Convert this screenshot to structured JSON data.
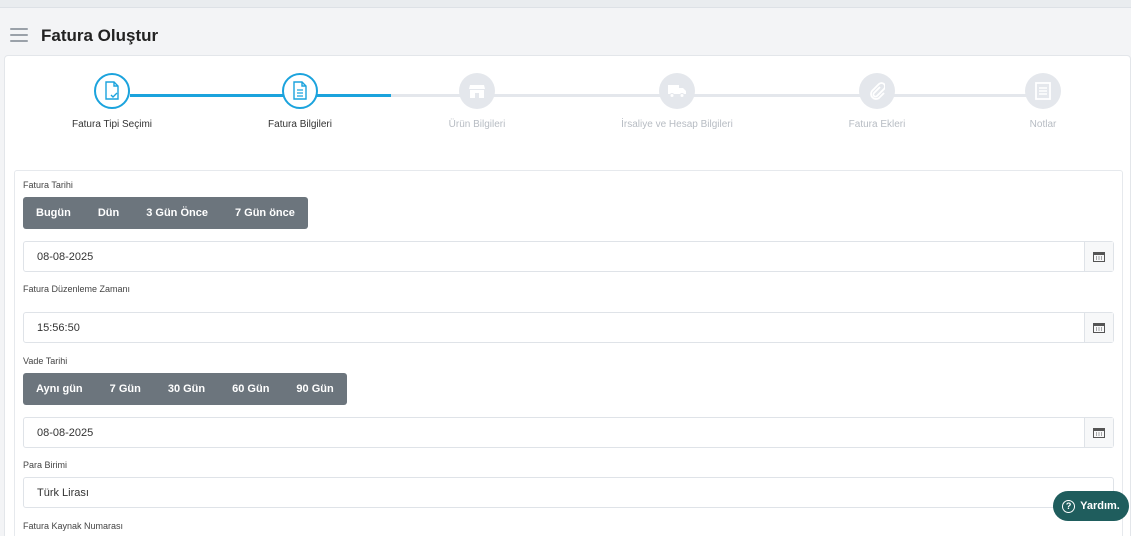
{
  "header": {
    "title": "Fatura Oluştur"
  },
  "stepper": {
    "steps": [
      {
        "label": "Fatura Tipi Seçimi",
        "state": "active",
        "icon": "document-check-icon"
      },
      {
        "label": "Fatura Bilgileri",
        "state": "active",
        "icon": "document-lines-icon"
      },
      {
        "label": "Ürün Bilgileri",
        "state": "inactive",
        "icon": "store-icon"
      },
      {
        "label": "İrsaliye ve Hesap Bilgileri",
        "state": "inactive",
        "icon": "truck-icon"
      },
      {
        "label": "Fatura Ekleri",
        "state": "inactive",
        "icon": "paperclip-icon"
      },
      {
        "label": "Notlar",
        "state": "inactive",
        "icon": "notes-icon"
      }
    ]
  },
  "form": {
    "invoice_date": {
      "label": "Fatura Tarihi",
      "quick": [
        "Bugün",
        "Dün",
        "3 Gün Önce",
        "7 Gün önce"
      ],
      "value": "08-08-2025"
    },
    "issue_time": {
      "label": "Fatura Düzenleme Zamanı",
      "value": "15:56:50"
    },
    "due_date": {
      "label": "Vade Tarihi",
      "quick": [
        "Aynı gün",
        "7 Gün",
        "30 Gün",
        "60 Gün",
        "90 Gün"
      ],
      "value": "08-08-2025"
    },
    "currency": {
      "label": "Para Birimi",
      "value": "Türk Lirası"
    },
    "source_number": {
      "label": "Fatura Kaynak Numarası"
    }
  },
  "help": {
    "label": "Yardım."
  },
  "colors": {
    "accent": "#1ba3dd",
    "button_group": "#6c757d",
    "help": "#1f5d5d"
  }
}
